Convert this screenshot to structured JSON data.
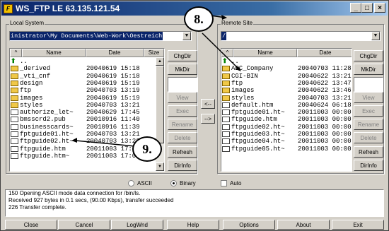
{
  "window": {
    "title": "WS_FTP LE 63.135.121.54",
    "app_icon_glyph": "F"
  },
  "local": {
    "label": "Local System",
    "path": "inistrator\\My Documents\\Web-Work\\Oestreich",
    "headers": {
      "name": "Name",
      "date": "Date",
      "size": "Size"
    },
    "rows": [
      {
        "icon": "up-arrow-icon",
        "name": "..",
        "date": ""
      },
      {
        "icon": "folder-icon",
        "name": "_derived",
        "date": "20040619 15:18"
      },
      {
        "icon": "folder-icon",
        "name": "_vti_cnf",
        "date": "20040619 15:18"
      },
      {
        "icon": "folder-icon",
        "name": "design",
        "date": "20040619 15:19"
      },
      {
        "icon": "folder-icon",
        "name": "ftp",
        "date": "20040703 13:19"
      },
      {
        "icon": "folder-icon",
        "name": "images",
        "date": "20040619 15:19"
      },
      {
        "icon": "folder-icon",
        "name": "styles",
        "date": "20040703 13:21"
      },
      {
        "icon": "file-icon",
        "name": "authorize_let~",
        "date": "20040629 17:45"
      },
      {
        "icon": "file-icon",
        "name": "bmsscrd2.pub",
        "date": "20010916 11:40"
      },
      {
        "icon": "file-icon",
        "name": "businesscards~",
        "date": "20010916 11:39"
      },
      {
        "icon": "file-icon",
        "name": "fptguide01.ht~",
        "date": "20040703 13:21"
      },
      {
        "icon": "file-icon",
        "name": "ftpguide02.ht~",
        "date": "20040703 13:22"
      },
      {
        "icon": "file-icon",
        "name": "ftpguide.htm",
        "date": "20011003 17:06"
      },
      {
        "icon": "file-icon",
        "name": "ftpguide.htm~",
        "date": "20011003 17:06"
      }
    ],
    "buttons": [
      "ChgDir",
      "MkDir",
      "",
      "View",
      "Exec",
      "Rename",
      "Delete",
      "Refresh",
      "DirInfo"
    ]
  },
  "remote": {
    "label": "Remote Site",
    "path": "/",
    "headers": {
      "name": "Name",
      "date": "Date"
    },
    "rows": [
      {
        "icon": "up-arrow-icon",
        "name": "..",
        "date": ""
      },
      {
        "icon": "folder-icon",
        "name": "ABC_Company",
        "date": "20040703 11:28"
      },
      {
        "icon": "folder-icon",
        "name": "CGI-BIN",
        "date": "20040622 13:21"
      },
      {
        "icon": "folder-icon",
        "name": "ftp",
        "date": "20040622 13:47"
      },
      {
        "icon": "folder-icon",
        "name": "images",
        "date": "20040622 13:46"
      },
      {
        "icon": "folder-icon",
        "name": "styles",
        "date": "20040703 13:21"
      },
      {
        "icon": "file-icon",
        "name": "default.htm",
        "date": "20040624 06:18"
      },
      {
        "icon": "file-icon",
        "name": "fptguide01.ht~",
        "date": "20011003 00:00"
      },
      {
        "icon": "file-icon",
        "name": "ftpguide.htm",
        "date": "20011003 00:00"
      },
      {
        "icon": "file-icon",
        "name": "ftpguide02.ht~",
        "date": "20011003 00:00"
      },
      {
        "icon": "file-icon",
        "name": "ftpguide03.ht~",
        "date": "20011003 00:00"
      },
      {
        "icon": "file-icon",
        "name": "ftpguide04.ht~",
        "date": "20011003 00:00"
      },
      {
        "icon": "file-icon",
        "name": "ftpguide05.ht~",
        "date": "20011003 00:00"
      }
    ],
    "buttons": [
      "ChgDir",
      "MkDir",
      "",
      "View",
      "Exec",
      "Rename",
      "Delete",
      "Refresh",
      "DirInfo"
    ]
  },
  "transfer": {
    "to_remote": "-->",
    "to_local": "<--"
  },
  "mode": {
    "ascii": "ASCII",
    "binary": "Binary",
    "auto": "Auto",
    "selected": "Binary"
  },
  "log": [
    "150 Opening ASCII mode data connection for /bin/ls.",
    "Received 927 bytes in 0.1 secs, (90.00 Kbps), transfer succeeded",
    "226 Transfer complete."
  ],
  "bottom_buttons": [
    "Close",
    "Cancel",
    "LogWnd",
    "Help",
    "Options",
    "About",
    "Exit"
  ],
  "callouts": [
    "8.",
    "9."
  ]
}
